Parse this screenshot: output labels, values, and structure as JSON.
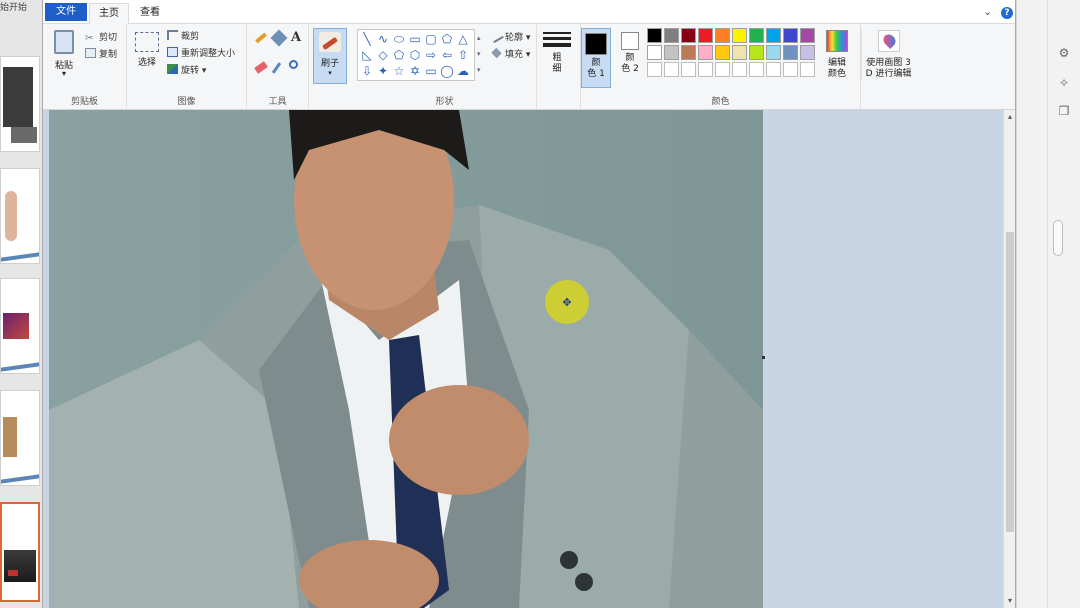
{
  "background_app": {
    "top_label": "始开始"
  },
  "tabs": {
    "file": "文件",
    "home": "主页",
    "view": "查看",
    "collapse": "⌄",
    "help": "?"
  },
  "clipboard": {
    "paste": "粘贴",
    "cut": "剪切",
    "copy": "复制",
    "group_label": "剪贴板"
  },
  "image": {
    "select": "选择",
    "crop": "裁剪",
    "resize": "重新调整大小",
    "rotate": "旋转",
    "group_label": "图像"
  },
  "tools": {
    "text_icon": "A",
    "group_label": "工具"
  },
  "brushes": {
    "label": "刷子"
  },
  "shapes": {
    "outline": "轮廓",
    "fill": "填充",
    "group_label": "形状"
  },
  "size": {
    "label_line1": "粗",
    "label_line2": "细"
  },
  "colors": {
    "color1_line1": "颜",
    "color1_line2": "色 1",
    "color2_line1": "颜",
    "color2_line2": "色 2",
    "edit_colors_line1": "编辑",
    "edit_colors_line2": "颜色",
    "paint3d_line1": "使用画图 3",
    "paint3d_line2": "D 进行编辑",
    "group_label": "颜色",
    "color1": "#000000",
    "color2": "#ffffff",
    "palette_row1": [
      "#000000",
      "#7f7f7f",
      "#880015",
      "#ed1c24",
      "#ff7f27",
      "#fff200",
      "#22b14c",
      "#00a2e8",
      "#3f48cc",
      "#a349a4"
    ],
    "palette_row2": [
      "#ffffff",
      "#c3c3c3",
      "#b97a57",
      "#ffaec9",
      "#ffc90e",
      "#efe4b0",
      "#b5e61d",
      "#99d9ea",
      "#7092be",
      "#c8bfe7"
    ]
  }
}
